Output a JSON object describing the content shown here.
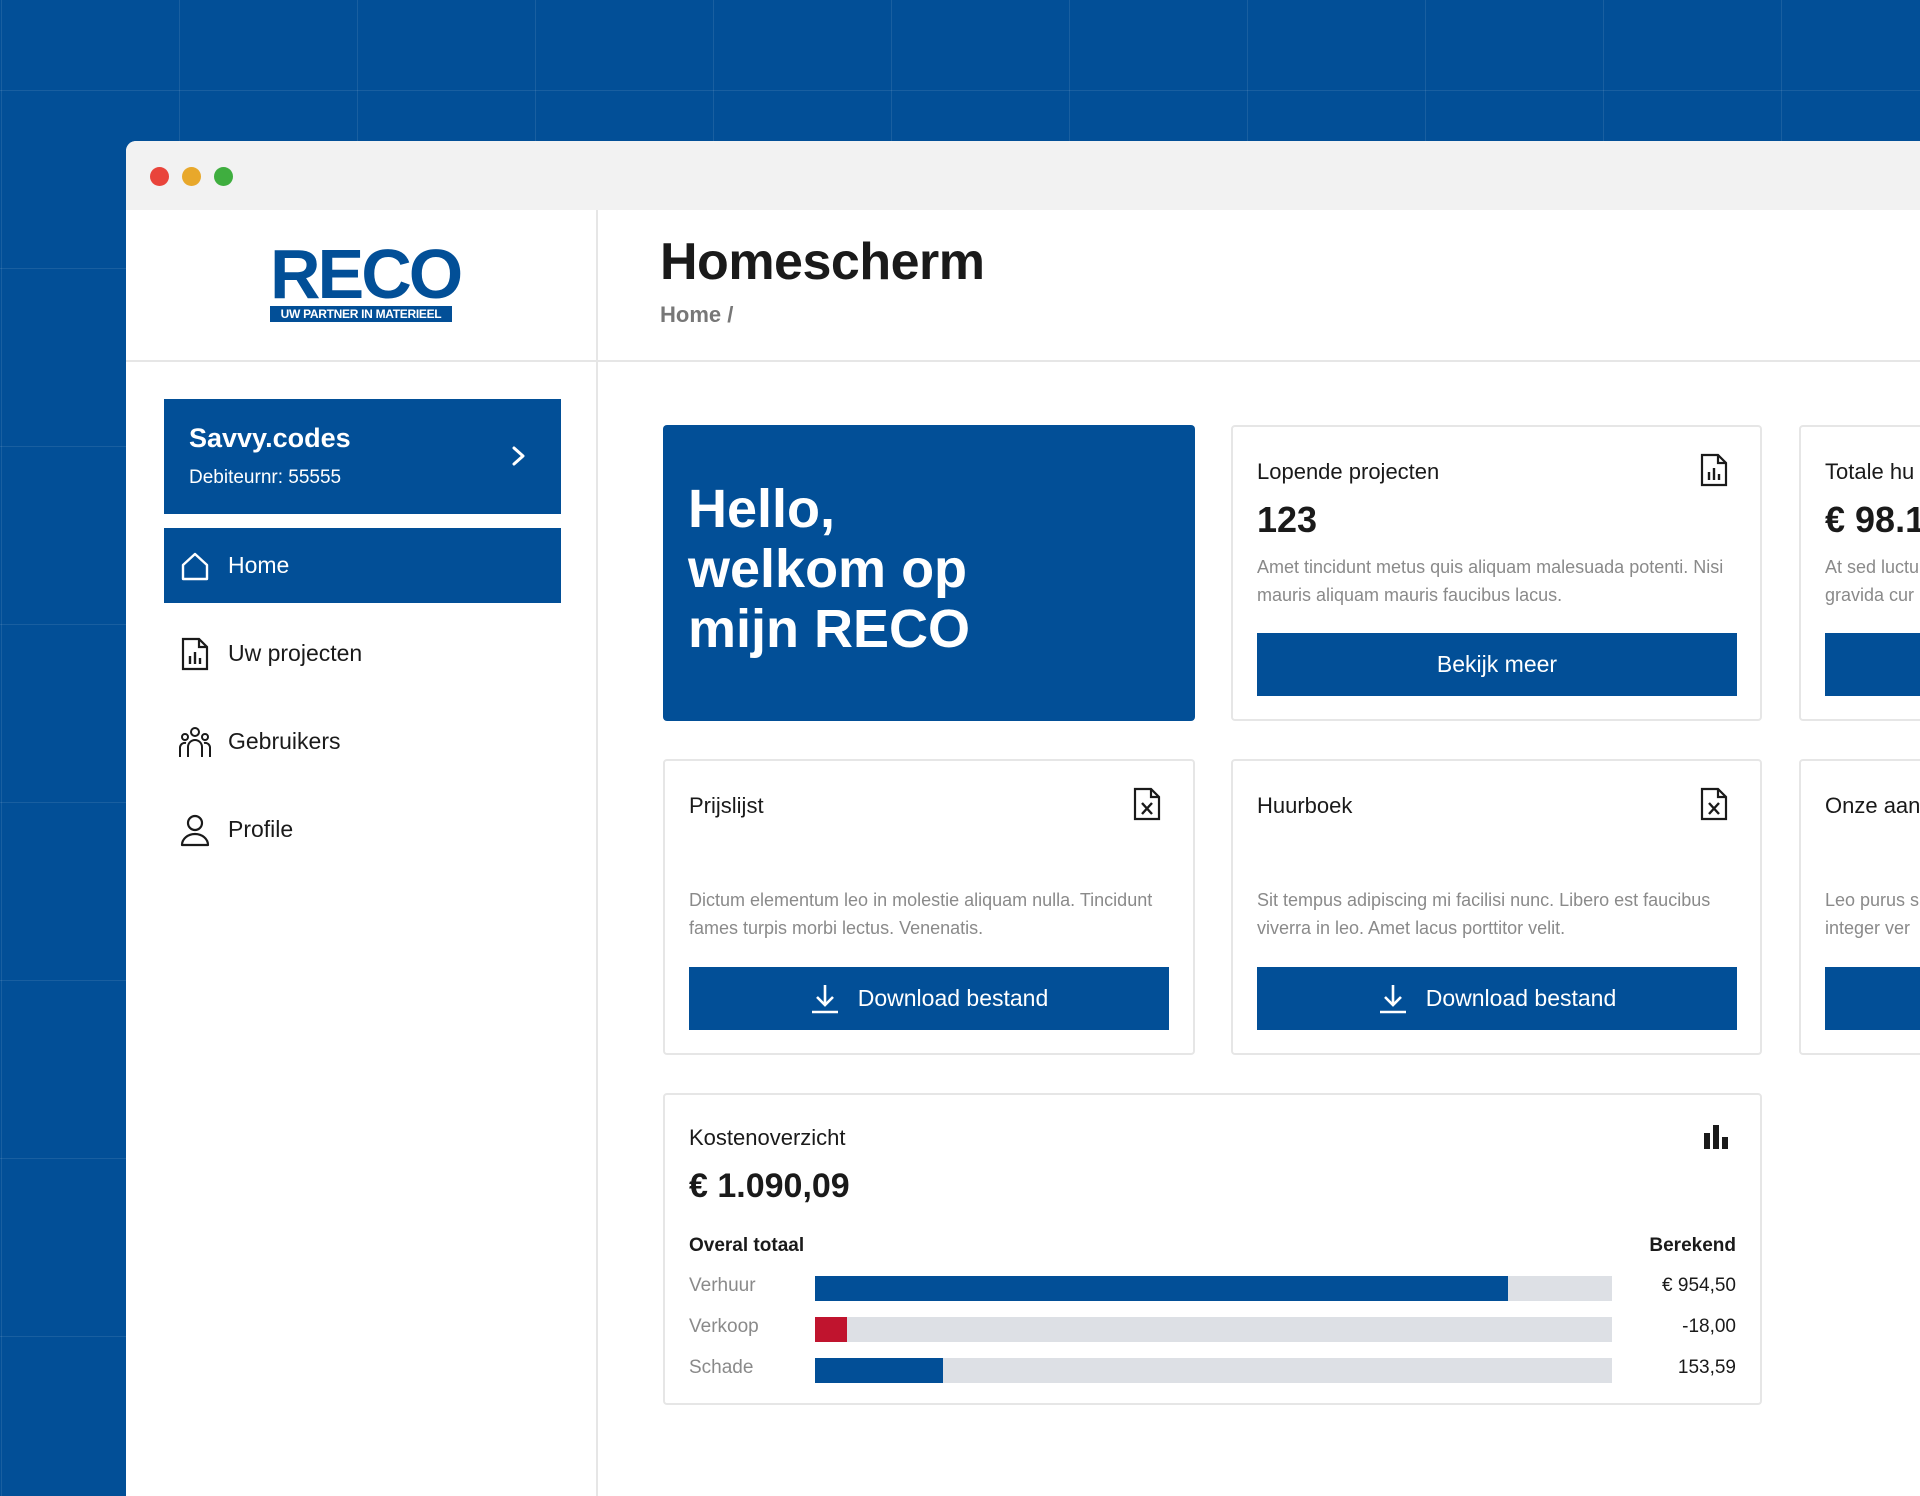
{
  "logo": {
    "word": "RECO",
    "tagline": "UW PARTNER IN MATERIEEL"
  },
  "header": {
    "title": "Homescherm",
    "breadcrumb": "Home /"
  },
  "account": {
    "name": "Savvy.codes",
    "debtor": "Debiteurnr: 55555",
    "icon": "chevron-right-icon"
  },
  "sidebar": {
    "items": [
      {
        "label": "Home",
        "icon": "home-icon",
        "active": true
      },
      {
        "label": "Uw projecten",
        "icon": "report-icon",
        "active": false
      },
      {
        "label": "Gebruikers",
        "icon": "users-icon",
        "active": false
      },
      {
        "label": "Profile",
        "icon": "user-icon",
        "active": false
      }
    ]
  },
  "hero": {
    "line1": "Hello,",
    "line2": "welkom op",
    "line3": "mijn RECO"
  },
  "cards": {
    "lopende": {
      "title": "Lopende projecten",
      "value": "123",
      "icon": "report-icon",
      "desc": "Amet tincidunt metus quis aliquam malesuada potenti. Nisi mauris aliquam mauris faucibus lacus.",
      "button": "Bekijk meer"
    },
    "totale": {
      "title": "Totale hu",
      "value": "€ 98.1",
      "desc": "At sed luctu gravida cur"
    },
    "prijslijst": {
      "title": "Prijslijst",
      "icon": "excel-file-icon",
      "desc": "Dictum elementum leo in molestie aliquam nulla. Tincidunt fames turpis morbi lectus. Venenatis.",
      "button": "Download bestand",
      "button_icon": "download-icon"
    },
    "huurboek": {
      "title": "Huurboek",
      "icon": "excel-file-icon",
      "desc": "Sit tempus adipiscing mi facilisi nunc. Libero est faucibus viverra in leo. Amet lacus porttitor velit.",
      "button": "Download bestand",
      "button_icon": "download-icon"
    },
    "onze": {
      "title": "Onze aan",
      "desc": "Leo purus s integer ver"
    }
  },
  "costs": {
    "title": "Kostenoverzicht",
    "icon": "bar-chart-icon",
    "total": "€ 1.090,09",
    "head_left": "Overal totaal",
    "head_right": "Berekend",
    "rows": [
      {
        "label": "Verhuur",
        "value": "€ 954,50",
        "fill": 0.87,
        "color": "#024f97"
      },
      {
        "label": "Verkoop",
        "value": "-18,00",
        "fill": 0.04,
        "color": "#c0142e"
      },
      {
        "label": "Schade",
        "value": "153,59",
        "fill": 0.16,
        "color": "#024f97"
      }
    ]
  },
  "colors": {
    "brand": "#024f97",
    "negative": "#c0142e",
    "track": "#dde0e5"
  }
}
